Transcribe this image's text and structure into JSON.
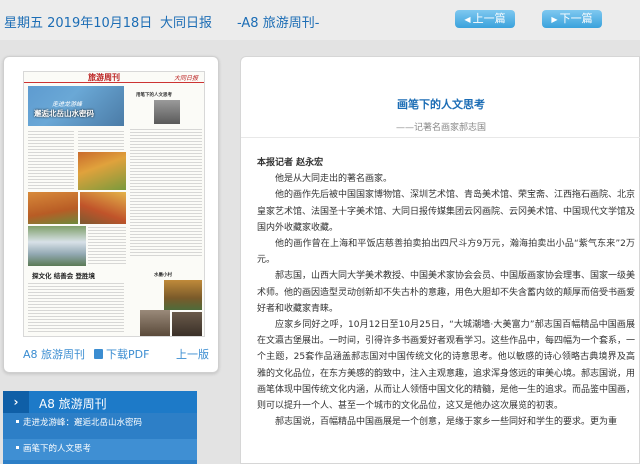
{
  "header": {
    "date": "星期五 2019年10月18日",
    "paper": "大同日报",
    "edition": "-A8 旅游周刊-",
    "prev_label": "上一篇",
    "next_label": "下一篇"
  },
  "thumbnail": {
    "masthead": "旅游周刊",
    "logo": "大同日报",
    "headline_small": "走进龙游峰",
    "headline_big": "邂逅北岳山水密码",
    "col_head_1": "用笔下的人文思考",
    "col_head_2": "水墨小村",
    "bottom_title": "探文化 结善会 登胜境",
    "link_edition": "A8 旅游周刊",
    "link_pdf": "下载PDF",
    "link_prev": "上一版"
  },
  "sidebar": {
    "section_label": "A8 旅游周刊",
    "items": [
      {
        "label": "走进龙游峰：邂逅北岳山水密码"
      },
      {
        "label": "画笔下的人文思考"
      }
    ]
  },
  "article": {
    "title": "画笔下的人文思考",
    "subtitle": "——记著名画家郝志国",
    "author": "本报记者 赵永宏",
    "paragraphs": [
      "他是从大同走出的著名画家。",
      "他的画作先后被中国国家博物馆、深圳艺术馆、青岛美术馆、荣宝斋、江西拖石画院、北京皇家艺术馆、法国圣十字美术馆、大同日报传媒集团云冈画院、云冈美术馆、中国现代文学馆及国内外收藏家收藏。",
      "他的画作曾在上海和平饭店慈善拍卖拍出四尺斗方9万元，瀚海拍卖出小品“紫气东来”2万元。",
      "郝志国，山西大同大学美术教授、中国美术家协会会员、中国版画家协会理事、国家一级美术师。他的画因造型灵动创新却不失古朴的意趣，用色大胆却不失含蓄内敛的颠厚而倍受书画爱好者和收藏家青睐。",
      "应家乡同好之呼，10月12日至10月25日，“大城潮墙·大美富力”郝志国百幅精品中国画展在文瀛古堡展出。一时间，引得许多书画爱好者观看学习。这些作品中，每四幅为一个套系，一个主题，25套作品涵盖郝志国对中国传统文化的诗意思考。他以敏感的诗心领略古典境界及高雅的文化品位，在东方美感的韵致中，注入主观意趣，追求浑身悠远的审美心境。郝志国说，用画笔体现中国传统文化内涵，从而让人领悟中国文化的精髓，是他一生的追求。而品鉴中国画，则可以提升一个人、甚至一个城市的文化品位，这又是他办这次展览的初衷。",
      "郝志国说，百幅精品中国画展是一个创意，是缘于家乡一些同好和学生的要求。更为重"
    ]
  },
  "colors": {
    "accent": "#1c6db5",
    "button": "#3aa2dc",
    "sidebar": "#1d7ac8"
  }
}
